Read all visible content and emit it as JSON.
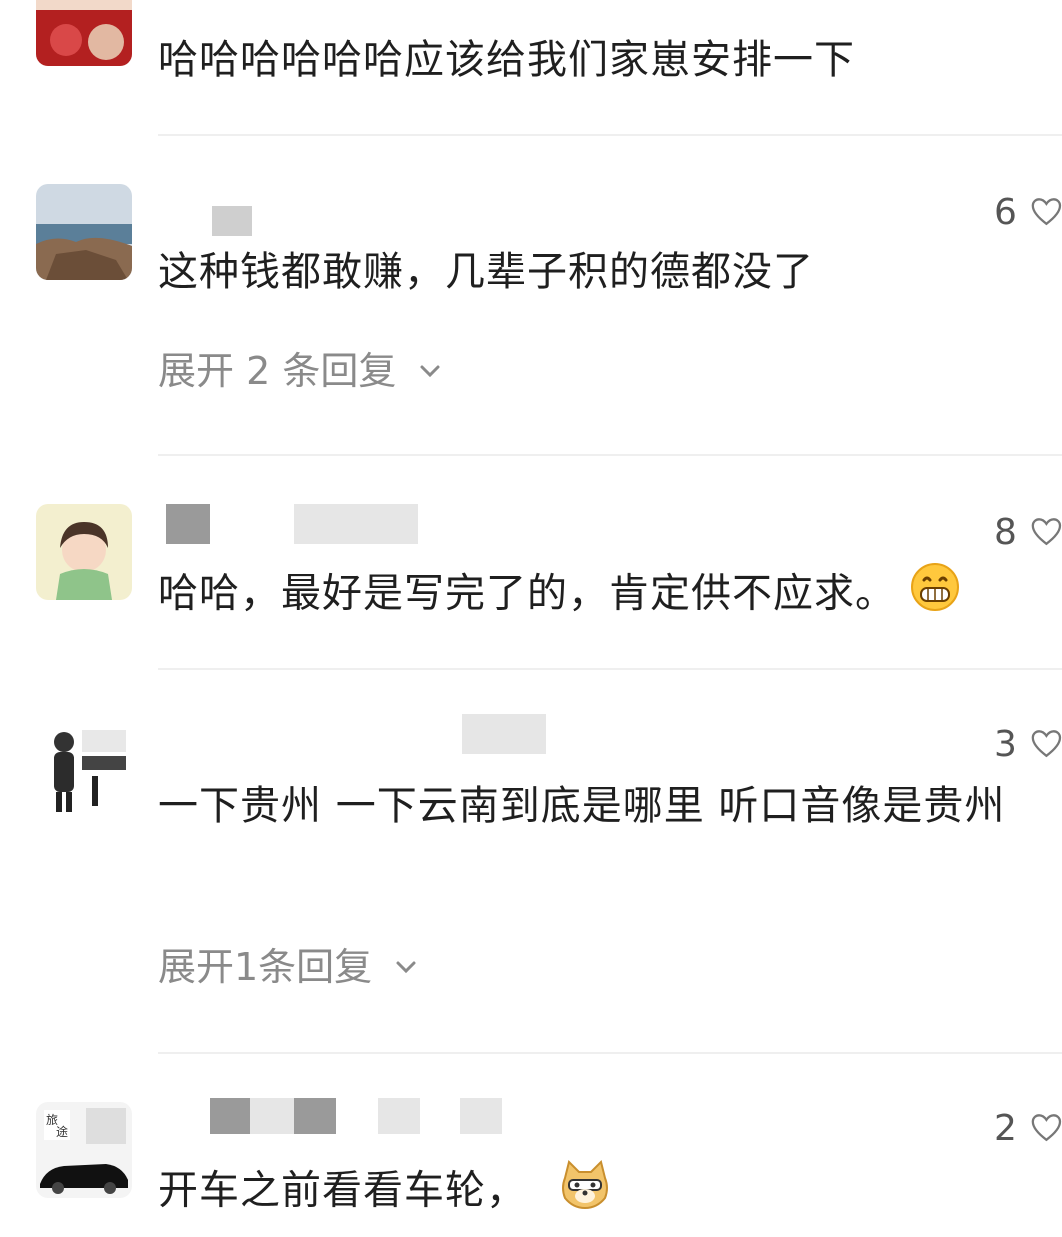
{
  "comments": [
    {
      "text": "哈哈哈哈哈哈应该给我们家崽安排一下"
    },
    {
      "text": "这种钱都敢赚，几辈子积的德都没了",
      "likes": "6",
      "replies_label": "展开 2 条回复"
    },
    {
      "text": "哈哈，最好是写完了的，肯定供不应求。",
      "likes": "8",
      "emoji": "grinning-face-emoji"
    },
    {
      "text": "一下贵州 一下云南到底是哪里 听口音像是贵州",
      "likes": "3",
      "replies_label": "展开1条回复"
    },
    {
      "text": "开车之前看看车轮，",
      "likes": "2",
      "emoji": "doge-emoji"
    }
  ],
  "icons": {
    "like": "heart-outline-icon",
    "expand": "chevron-down-icon"
  },
  "colors": {
    "text": "#1f1f1f",
    "secondary": "#8a8a8a",
    "divider": "#efefef"
  }
}
